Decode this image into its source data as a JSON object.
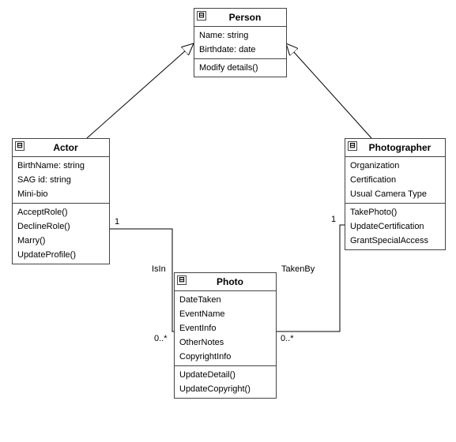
{
  "classes": {
    "person": {
      "name": "Person",
      "attributes": [
        "Name: string",
        "Birthdate: date"
      ],
      "operations": [
        "Modify details()"
      ]
    },
    "actor": {
      "name": "Actor",
      "attributes": [
        "BirthName: string",
        "SAG id: string",
        "Mini-bio"
      ],
      "operations": [
        "AcceptRole()",
        "DeclineRole()",
        "Marry()",
        "UpdateProfile()"
      ]
    },
    "photographer": {
      "name": "Photographer",
      "attributes": [
        "Organization",
        "Certification",
        "Usual Camera Type"
      ],
      "operations": [
        "TakePhoto()",
        "UpdateCertification",
        "GrantSpecialAccess"
      ]
    },
    "photo": {
      "name": "Photo",
      "attributes": [
        "DateTaken",
        "EventName",
        "EventInfo",
        "OtherNotes",
        "CopyrightInfo"
      ],
      "operations": [
        "UpdateDetail()",
        "UpdateCopyright()"
      ]
    }
  },
  "associations": {
    "isIn": {
      "label": "IsIn",
      "end1_mult": "1",
      "end2_mult": "0..*"
    },
    "takenBy": {
      "label": "TakenBy",
      "end1_mult": "1",
      "end2_mult": "0..*"
    }
  },
  "collapseGlyph": "⊟"
}
